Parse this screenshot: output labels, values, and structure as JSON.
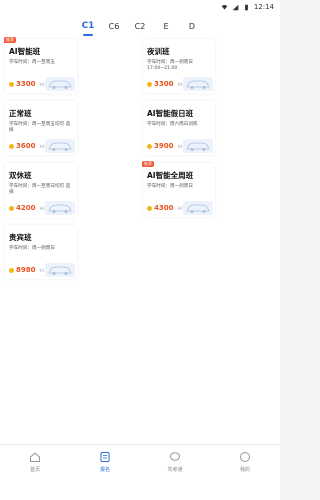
{
  "status_bar": {
    "time": "12:14"
  },
  "tabs": [
    {
      "label": "C1",
      "active": true
    },
    {
      "label": "C6",
      "active": false
    },
    {
      "label": "C2",
      "active": false
    },
    {
      "label": "E",
      "active": false
    },
    {
      "label": "D",
      "active": false
    }
  ],
  "cards": [
    {
      "title": "AI智能班",
      "time_label": "学车时间：",
      "time_value": "周一至周五",
      "price": "3300",
      "orig_price": "¥4800",
      "hot": true,
      "hot_label": "推荐"
    },
    {
      "title": "夜训班",
      "time_label": "学车时间：",
      "time_value": "周一到周日 17:00~21:00",
      "price": "3300",
      "orig_price": "¥4800",
      "hot": false,
      "hot_label": ""
    },
    {
      "title": "正常班",
      "time_label": "学车时间：",
      "time_value": "周一至周五均可 选择",
      "price": "3600",
      "orig_price": "¥4800",
      "hot": false,
      "hot_label": ""
    },
    {
      "title": "AI智能假日班",
      "time_label": "学车时间：",
      "time_value": "周六周日训练",
      "price": "3900",
      "orig_price": "¥4800",
      "hot": false,
      "hot_label": ""
    },
    {
      "title": "双休班",
      "time_label": "学车时间：",
      "time_value": "周一至周日均可 选择",
      "price": "4200",
      "orig_price": "¥4800",
      "hot": false,
      "hot_label": ""
    },
    {
      "title": "AI智能全周班",
      "time_label": "学车时间：",
      "time_value": "周一到周日",
      "price": "4300",
      "orig_price": "¥4800",
      "hot": true,
      "hot_label": "推荐"
    },
    {
      "title": "贵宾班",
      "time_label": "学车时间：",
      "time_value": "周一到周日",
      "price": "8980",
      "orig_price": "¥15800",
      "hot": false,
      "hot_label": ""
    }
  ],
  "bottom_nav": [
    {
      "label": "首页",
      "icon": "home-icon",
      "active": false
    },
    {
      "label": "报名",
      "icon": "signup-icon",
      "active": true
    },
    {
      "label": "驾考通",
      "icon": "chat-icon",
      "active": false
    },
    {
      "label": "我的",
      "icon": "profile-icon",
      "active": false
    }
  ],
  "colors": {
    "accent": "#2a6ee0",
    "price": "#e9531f",
    "coin": "#f5b716",
    "hot": "#f35a3a"
  }
}
